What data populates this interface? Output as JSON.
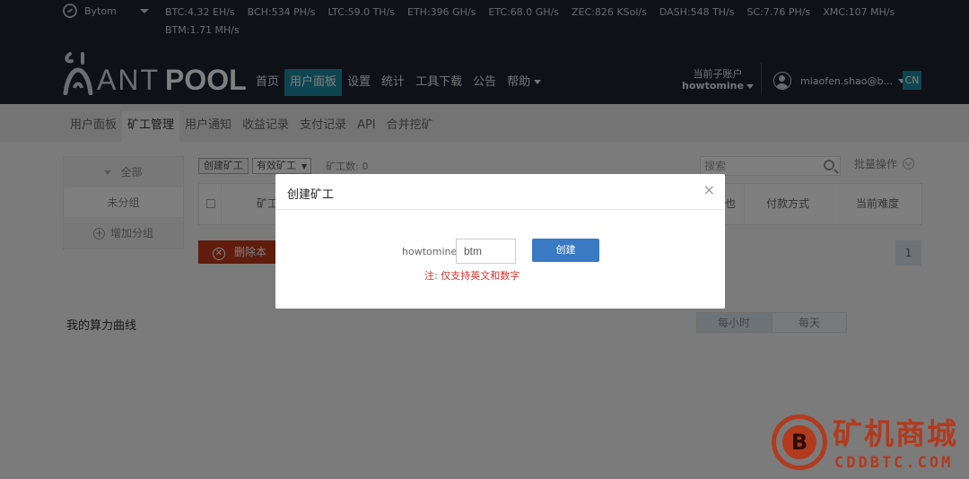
{
  "header": {
    "coin": "Bytom",
    "rates": [
      "BTC:4.32 EH/s",
      "BCH:534 PH/s",
      "LTC:59.0 TH/s",
      "ETH:396 GH/s",
      "ETC:68.0 GH/s",
      "ZEC:826 KSol/s",
      "DASH:548 TH/s",
      "SC:7.76 PH/s",
      "XMC:107 MH/s",
      "BTM:1.71 MH/s"
    ],
    "logo": {
      "ant": "ANT",
      "pool": "POOL"
    },
    "nav": [
      "首页",
      "用户面板",
      "设置",
      "统计",
      "工具下载",
      "公告",
      "帮助"
    ],
    "nav_active": "用户面板",
    "subaccount_label": "当前子账户",
    "subaccount_value": "howtomine",
    "user_email": "miaofen.shao@b...",
    "lang": "CN"
  },
  "subnav": {
    "tabs": [
      "用户面板",
      "矿工管理",
      "用户通知",
      "收益记录",
      "支付记录",
      "API",
      "合并挖矿"
    ],
    "active": "矿工管理"
  },
  "groups": {
    "all": "全部",
    "ungrouped": "未分组",
    "add": "增加分组"
  },
  "toolbar": {
    "create_worker": "创建矿工",
    "filter": "有效矿工",
    "worker_count": "矿工数: 0",
    "search_placeholder": "搜索",
    "batch": "批量操作"
  },
  "table": {
    "col_worker": "矿工",
    "col_partial": "也",
    "col_payment": "付款方式",
    "col_difficulty": "当前难度"
  },
  "actions": {
    "delete": "删除本"
  },
  "pagination": {
    "page": "1"
  },
  "chart": {
    "title": "我的算力曲线",
    "hourly": "每小时",
    "daily": "每天"
  },
  "modal": {
    "title": "创建矿工",
    "close": "×",
    "prefix": "howtomine.",
    "input_value": "btm",
    "create": "创建",
    "note": "注: 仅支持英文和数字"
  },
  "watermark": {
    "text_cn": "矿机商城",
    "text_en": "CDDBTC.COM",
    "badge": "B"
  },
  "colors": {
    "topbar": "#1f2233",
    "accent": "#1f8aa0",
    "danger": "#c0391b",
    "primary_button": "#3a79c4",
    "note": "#d9312b"
  }
}
